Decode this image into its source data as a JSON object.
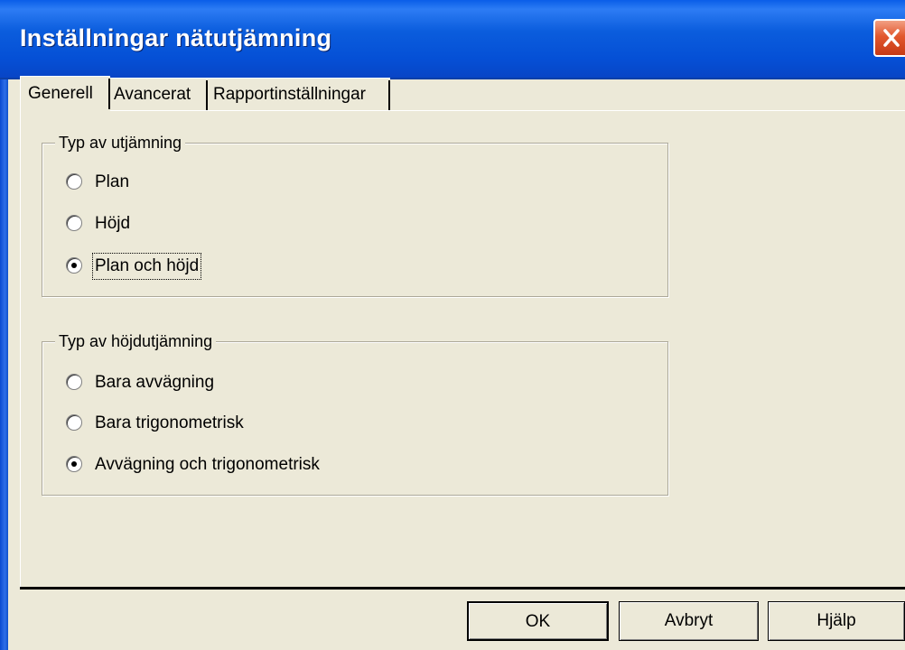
{
  "window": {
    "title": "Inställningar nätutjämning",
    "close_icon": "close-icon"
  },
  "tabs": [
    {
      "label": "Generell",
      "active": true
    },
    {
      "label": "Avancerat",
      "active": false
    },
    {
      "label": "Rapportinställningar",
      "active": false
    }
  ],
  "group_adjustment_type": {
    "legend": "Typ av utjämning",
    "options": [
      {
        "label": "Plan",
        "selected": false
      },
      {
        "label": "Höjd",
        "selected": false
      },
      {
        "label": "Plan och höjd",
        "selected": true
      }
    ]
  },
  "group_height_adjustment_type": {
    "legend": "Typ av höjdutjämning",
    "options": [
      {
        "label": "Bara avvägning",
        "selected": false
      },
      {
        "label": "Bara trigonometrisk",
        "selected": false
      },
      {
        "label": "Avvägning och trigonometrisk",
        "selected": true
      }
    ]
  },
  "buttons": {
    "ok": "OK",
    "cancel": "Avbryt",
    "help": "Hjälp"
  }
}
